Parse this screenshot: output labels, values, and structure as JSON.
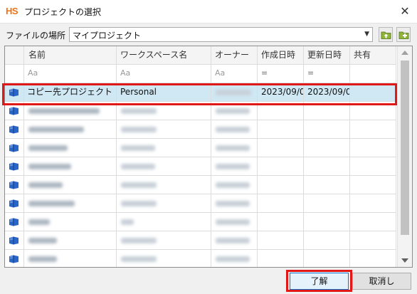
{
  "window": {
    "logo": "HS",
    "title": "プロジェクトの選択",
    "close": "✕"
  },
  "location": {
    "label": "ファイルの場所",
    "value": "マイプロジェクト",
    "arrow": "▼"
  },
  "table": {
    "columns": [
      "名前",
      "ワークスペース名",
      "オーナー",
      "作成日時",
      "更新日時",
      "共有"
    ],
    "filters": [
      "Aa",
      "Aa",
      "Aa",
      "=",
      "="
    ],
    "selected_row": {
      "name": "コピー先プロジェクト",
      "workspace": "Personal",
      "owner": "",
      "created": "2023/09/0",
      "updated": "2023/09/0",
      "shared": ""
    },
    "blurred_rows": 9
  },
  "buttons": {
    "ok": "了解",
    "cancel": "取消し"
  },
  "colors": {
    "highlight": "#e01818",
    "selection": "#cfe8f4",
    "logo": "#e8741a"
  }
}
